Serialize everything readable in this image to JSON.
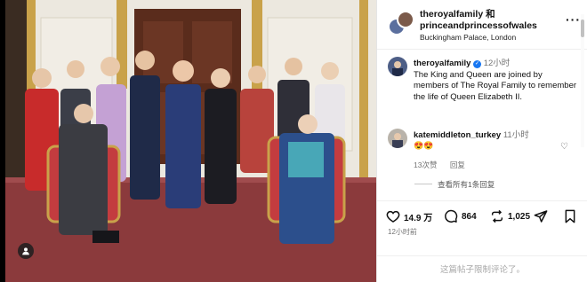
{
  "post": {
    "header": {
      "title": "theroyalfamily 和 princeandprincessofwales",
      "location": "Buckingham Palace, London",
      "more_icon": "more-horizontal-icon"
    },
    "caption": {
      "username": "theroyalfamily",
      "time": "12小时",
      "text": "The King and Queen are joined by members of The Royal Family to remember the life of Queen Elizabeth II."
    },
    "comment": {
      "username": "katemiddleton_turkey",
      "time": "11小时",
      "emoji": "😍😍",
      "likes": "13次赞",
      "reply": "回复"
    },
    "view_replies": "查看所有1条回复",
    "stats": {
      "likes": "14.9 万",
      "comments": "864",
      "shares": "1,025"
    },
    "date": "12小时前",
    "comments_disabled": "这篇帖子限制评论了。"
  },
  "colors": {
    "accent": "#1877f2",
    "carpet": "#8b3a3c",
    "wall": "#e8e4dc"
  }
}
